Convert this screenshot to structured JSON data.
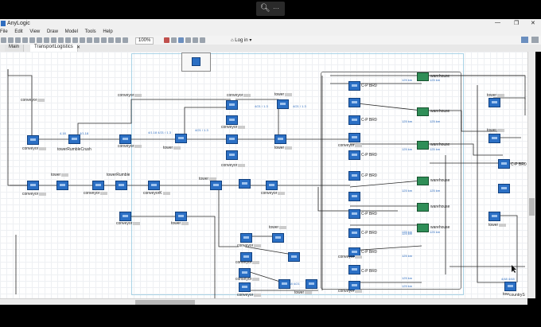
{
  "app": {
    "title": "AnyLogic",
    "window_controls": [
      "—",
      "❐",
      "✕"
    ]
  },
  "menu": [
    "File",
    "Edit",
    "View",
    "Draw",
    "Model",
    "Tools",
    "Help"
  ],
  "toolbar": {
    "zoom": "100%",
    "login": "Log in"
  },
  "video_controls": {
    "zoom_icon": "magnifier-icon",
    "more": "···"
  },
  "tabs": [
    {
      "label": "Main",
      "active": false
    },
    {
      "label": "TransportLogistics",
      "active": true
    }
  ],
  "canvas": {
    "labels": {
      "conveyor": "conveyor",
      "tower": "tower",
      "towerRumbleCrush": "towerRumbleCrush",
      "towerRumble": "towerRumble",
      "warehouse": "warehouse",
      "cp": "C-P BR0",
      "cp_right": "C-P BR0",
      "conveyorK": "conveyorK",
      "countryS": "countryS"
    }
  }
}
